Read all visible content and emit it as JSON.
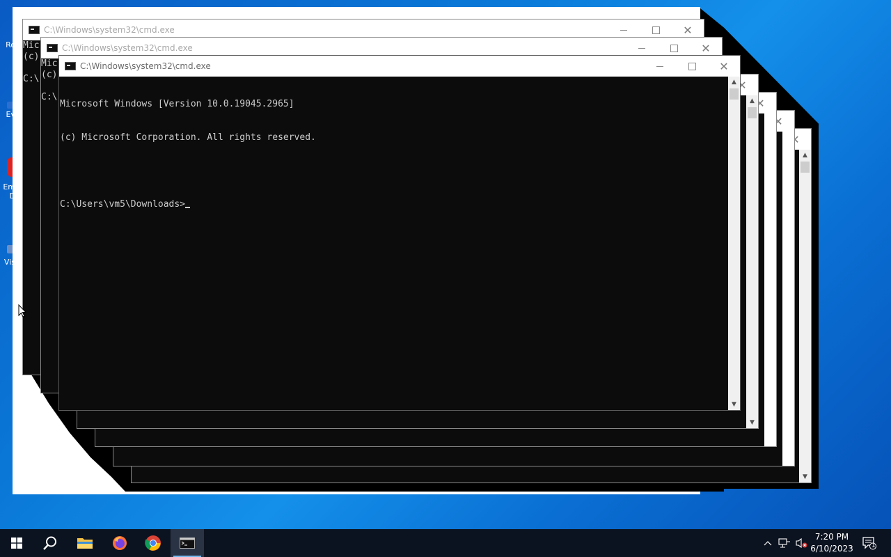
{
  "desktop": {
    "icons": [
      {
        "label": "Re",
        "name": "recycle-bin"
      },
      {
        "label": "Ev",
        "name": "desktop-app-ev"
      },
      {
        "label": "Em",
        "name": "desktop-app-em"
      },
      {
        "label": "D",
        "name": "desktop-app-em-line2"
      },
      {
        "label": "Vis",
        "name": "desktop-app-vis"
      }
    ]
  },
  "windows": [
    {
      "title": "C:\\Windows\\system32\\cmd.exe",
      "console_lines": [
        "Mic",
        "(c)",
        "",
        "C:\\"
      ]
    },
    {
      "title": "C:\\Windows\\system32\\cmd.exe",
      "console_lines": [
        "Mic",
        "(c)",
        "",
        "C:\\"
      ]
    },
    {
      "title": "C:\\Windows\\system32\\cmd.exe",
      "console_lines": [
        "Microsoft Windows [Version 10.0.19045.2965]",
        "(c) Microsoft Corporation. All rights reserved.",
        "",
        "C:\\Users\\vm5\\Downloads>"
      ]
    }
  ],
  "controls": {
    "minimize": "—",
    "maximize": "☐",
    "close": "✕"
  },
  "taskbar": {
    "apps": [
      {
        "name": "start",
        "icon": "windows-logo-icon"
      },
      {
        "name": "search",
        "icon": "search-icon"
      },
      {
        "name": "file-explorer",
        "icon": "folder-icon"
      },
      {
        "name": "firefox",
        "icon": "firefox-icon"
      },
      {
        "name": "chrome",
        "icon": "chrome-icon"
      },
      {
        "name": "command-prompt",
        "icon": "terminal-icon",
        "active": true
      }
    ],
    "time": "7:20 PM",
    "date": "6/10/2023",
    "notification_count": "1"
  }
}
